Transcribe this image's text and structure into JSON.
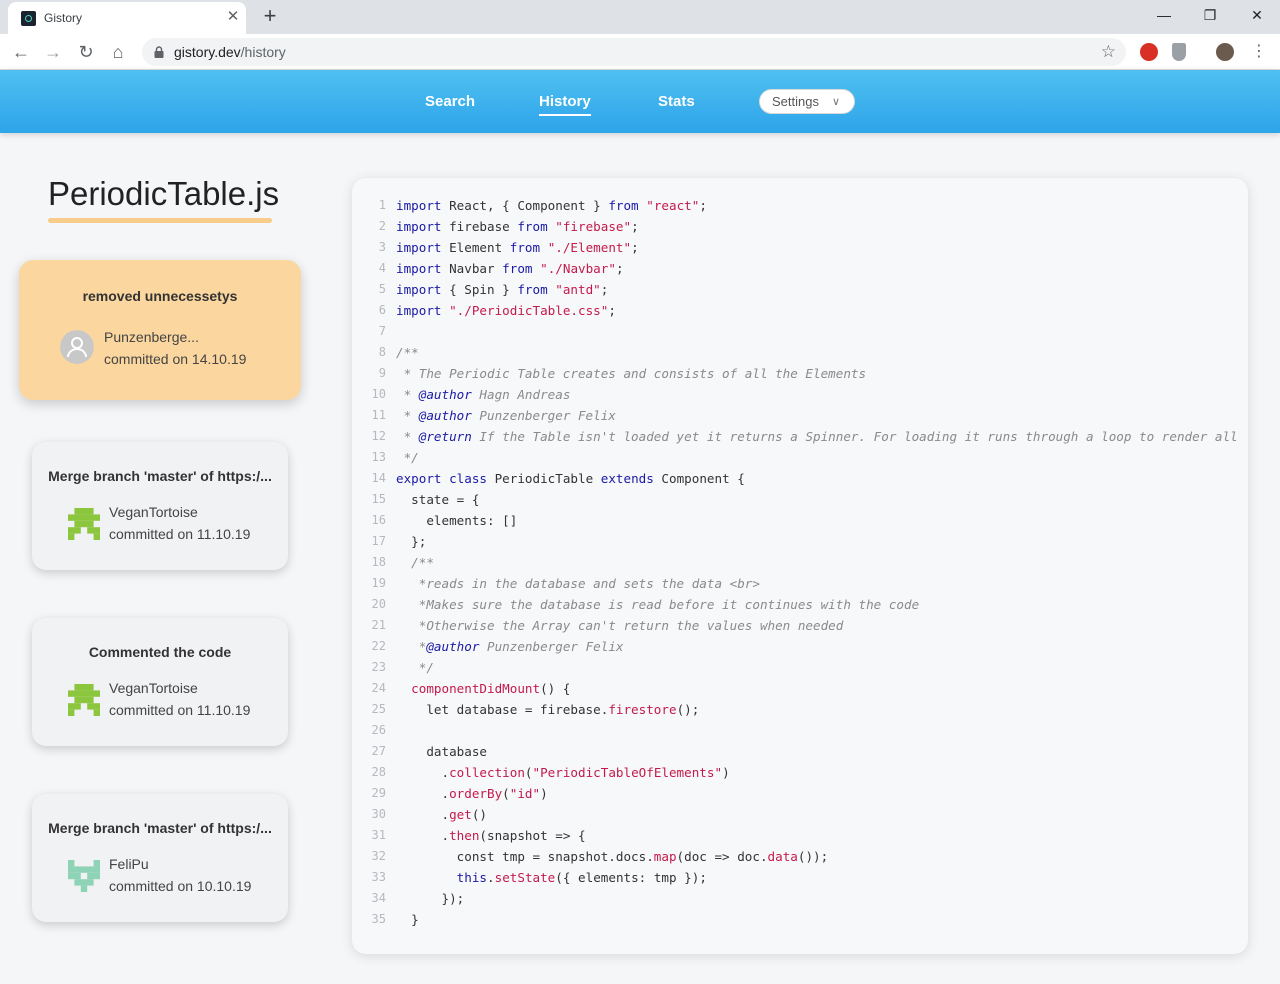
{
  "browser": {
    "tab_title": "Gistory",
    "url_host": "gistory.dev",
    "url_path": "/history"
  },
  "nav": {
    "search": "Search",
    "history": "History",
    "stats": "Stats",
    "settings": "Settings"
  },
  "file": {
    "name": "PeriodicTable.js"
  },
  "commits": [
    {
      "message": "removed unnecessetys",
      "author": "Punzenberge...",
      "date": "committed on 14.10.19",
      "active": true
    },
    {
      "message": "Merge branch 'master' of https:/...",
      "author": "VeganTortoise",
      "date": "committed on 11.10.19",
      "active": false
    },
    {
      "message": "Commented the code",
      "author": "VeganTortoise",
      "date": "committed on 11.10.19",
      "active": false
    },
    {
      "message": "Merge branch 'master' of https:/...",
      "author": "FeliPu",
      "date": "committed on 10.10.19",
      "active": false
    }
  ],
  "code": [
    [
      [
        "k",
        "import"
      ],
      [
        "t",
        " React, { Component } "
      ],
      [
        "k",
        "from"
      ],
      [
        "t",
        " "
      ],
      [
        "s",
        "\"react\""
      ],
      [
        "t",
        ";"
      ]
    ],
    [
      [
        "k",
        "import"
      ],
      [
        "t",
        " firebase "
      ],
      [
        "k",
        "from"
      ],
      [
        "t",
        " "
      ],
      [
        "s",
        "\"firebase\""
      ],
      [
        "t",
        ";"
      ]
    ],
    [
      [
        "k",
        "import"
      ],
      [
        "t",
        " Element "
      ],
      [
        "k",
        "from"
      ],
      [
        "t",
        " "
      ],
      [
        "s",
        "\"./Element\""
      ],
      [
        "t",
        ";"
      ]
    ],
    [
      [
        "k",
        "import"
      ],
      [
        "t",
        " Navbar "
      ],
      [
        "k",
        "from"
      ],
      [
        "t",
        " "
      ],
      [
        "s",
        "\"./Navbar\""
      ],
      [
        "t",
        ";"
      ]
    ],
    [
      [
        "k",
        "import"
      ],
      [
        "t",
        " { Spin } "
      ],
      [
        "k",
        "from"
      ],
      [
        "t",
        " "
      ],
      [
        "s",
        "\"antd\""
      ],
      [
        "t",
        ";"
      ]
    ],
    [
      [
        "k",
        "import"
      ],
      [
        "t",
        " "
      ],
      [
        "s",
        "\"./PeriodicTable.css\""
      ],
      [
        "t",
        ";"
      ]
    ],
    [],
    [
      [
        "c",
        "/**"
      ]
    ],
    [
      [
        "c",
        " * The Periodic Table creates and consists of all the Elements"
      ]
    ],
    [
      [
        "c",
        " * "
      ],
      [
        "ca",
        "@author"
      ],
      [
        "c",
        " Hagn Andreas"
      ]
    ],
    [
      [
        "c",
        " * "
      ],
      [
        "ca",
        "@author"
      ],
      [
        "c",
        " Punzenberger Felix"
      ]
    ],
    [
      [
        "c",
        " * "
      ],
      [
        "ca",
        "@return"
      ],
      [
        "c",
        " If the Table isn't loaded yet it returns a Spinner. For loading it runs through a loop to render all"
      ]
    ],
    [
      [
        "c",
        " */"
      ]
    ],
    [
      [
        "k",
        "export"
      ],
      [
        "t",
        " "
      ],
      [
        "k",
        "class"
      ],
      [
        "t",
        " PeriodicTable "
      ],
      [
        "k",
        "extends"
      ],
      [
        "t",
        " Component {"
      ]
    ],
    [
      [
        "t",
        "  state = {"
      ]
    ],
    [
      [
        "t",
        "    elements: []"
      ]
    ],
    [
      [
        "t",
        "  };"
      ]
    ],
    [
      [
        "c",
        "  /**"
      ]
    ],
    [
      [
        "c",
        "   *reads in the database and sets the data <br>"
      ]
    ],
    [
      [
        "c",
        "   *Makes sure the database is read before it continues with the code"
      ]
    ],
    [
      [
        "c",
        "   *Otherwise the Array can't return the values when needed"
      ]
    ],
    [
      [
        "c",
        "   *"
      ],
      [
        "ca",
        "@author"
      ],
      [
        "c",
        " Punzenberger Felix"
      ]
    ],
    [
      [
        "c",
        "   */"
      ]
    ],
    [
      [
        "f",
        "  componentDidMount"
      ],
      [
        "t",
        "() {"
      ]
    ],
    [
      [
        "t",
        "    let database = firebase."
      ],
      [
        "f",
        "firestore"
      ],
      [
        "t",
        "();"
      ]
    ],
    [],
    [
      [
        "t",
        "    database"
      ]
    ],
    [
      [
        "t",
        "      ."
      ],
      [
        "f",
        "collection"
      ],
      [
        "t",
        "("
      ],
      [
        "s",
        "\"PeriodicTableOfElements\""
      ],
      [
        "t",
        ")"
      ]
    ],
    [
      [
        "t",
        "      ."
      ],
      [
        "f",
        "orderBy"
      ],
      [
        "t",
        "("
      ],
      [
        "s",
        "\"id\""
      ],
      [
        "t",
        ")"
      ]
    ],
    [
      [
        "t",
        "      ."
      ],
      [
        "f",
        "get"
      ],
      [
        "t",
        "()"
      ]
    ],
    [
      [
        "t",
        "      ."
      ],
      [
        "f",
        "then"
      ],
      [
        "t",
        "(snapshot => {"
      ]
    ],
    [
      [
        "t",
        "        const tmp = snapshot.docs."
      ],
      [
        "f",
        "map"
      ],
      [
        "t",
        "(doc => doc."
      ],
      [
        "f",
        "data"
      ],
      [
        "t",
        "());"
      ]
    ],
    [
      [
        "t",
        "        "
      ],
      [
        "k",
        "this"
      ],
      [
        "t",
        "."
      ],
      [
        "f",
        "setState"
      ],
      [
        "t",
        "({ elements: tmp });"
      ]
    ],
    [
      [
        "t",
        "      });"
      ]
    ],
    [
      [
        "t",
        "  }"
      ]
    ]
  ]
}
